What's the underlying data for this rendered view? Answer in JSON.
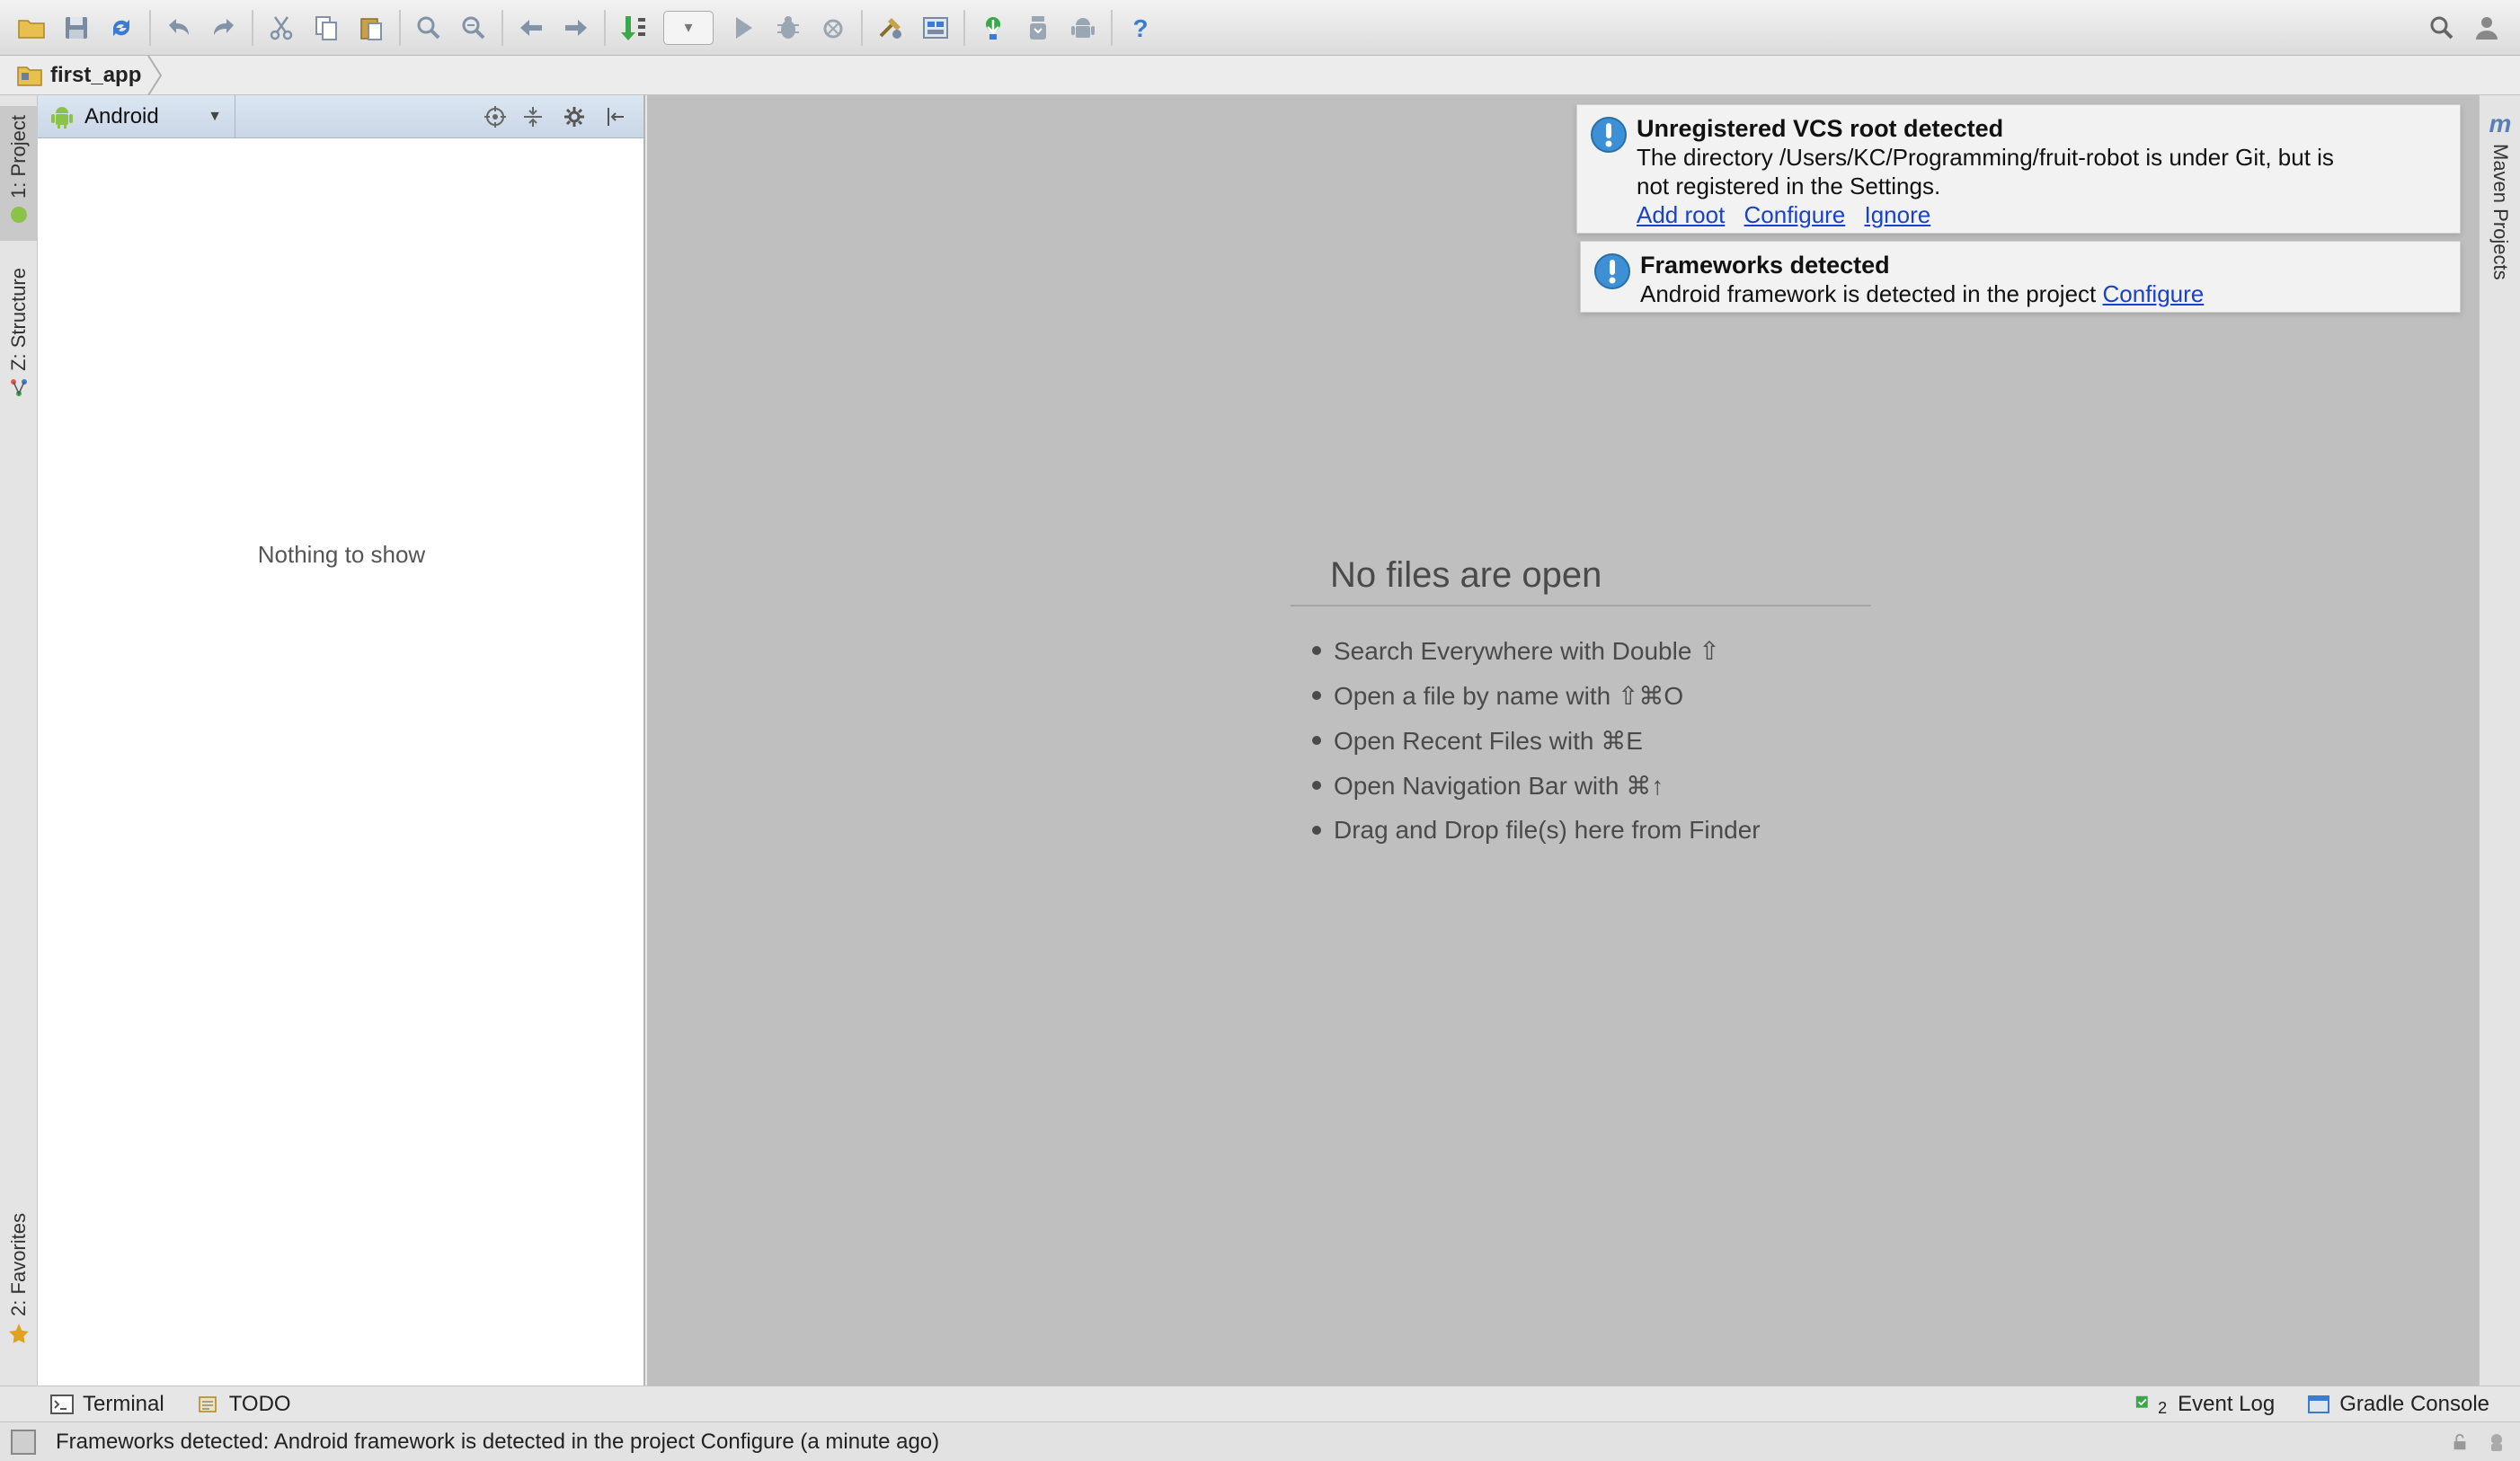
{
  "toolbar": {
    "left_icons": [
      "open-folder-icon",
      "save-icon",
      "sync-icon",
      "undo-icon",
      "redo-icon",
      "cut-icon",
      "copy-icon",
      "paste-icon",
      "find-icon",
      "replace-icon",
      "back-icon",
      "forward-icon",
      "make-project-icon",
      "run-config-combo",
      "run-icon",
      "debug-icon",
      "attach-debugger-icon",
      "project-structure-icon",
      "sdk-manager-icon",
      "avd-manager-icon",
      "android-device-monitor-icon",
      "help-icon"
    ],
    "right_icons": [
      "search-everywhere-icon",
      "user-icon"
    ]
  },
  "breadcrumb": {
    "project": "first_app"
  },
  "left_stripe": {
    "project_tab": "1: Project",
    "structure_tab": "Z: Structure",
    "favorites_tab": "2: Favorites"
  },
  "project_panel": {
    "view_mode": "Android",
    "empty_text": "Nothing to show"
  },
  "editor": {
    "empty_title": "No files are open",
    "hints": [
      "Search Everywhere with Double ⇧",
      "Open a file by name with ⇧⌘O",
      "Open Recent Files with ⌘E",
      "Open Navigation Bar with ⌘↑",
      "Drag and Drop file(s) here from Finder"
    ]
  },
  "notifications": {
    "vcs": {
      "title": "Unregistered VCS root detected",
      "body_line1": "The directory /Users/KC/Programming/fruit-robot is under Git, but is",
      "body_line2": "not registered in the Settings.",
      "link_add_root": "Add root",
      "link_configure": "Configure",
      "link_ignore": "Ignore"
    },
    "frameworks": {
      "title": "Frameworks detected",
      "body": "Android framework is detected in the project",
      "link_configure": "Configure"
    }
  },
  "right_stripe": {
    "maven_tab": "Maven Projects",
    "maven_glyph": "m"
  },
  "bottom_tools": {
    "terminal": "Terminal",
    "todo": "TODO",
    "event_log": "Event Log",
    "event_log_count": "2",
    "gradle_console": "Gradle Console"
  },
  "status_bar": {
    "message": "Frameworks detected: Android framework is detected in the project Configure (a minute ago)"
  },
  "colors": {
    "link": "#1a42c8",
    "editor_bg": "#bfbfbf",
    "notification_icon": "#3d8fd6",
    "android_green": "#8bc34a"
  }
}
